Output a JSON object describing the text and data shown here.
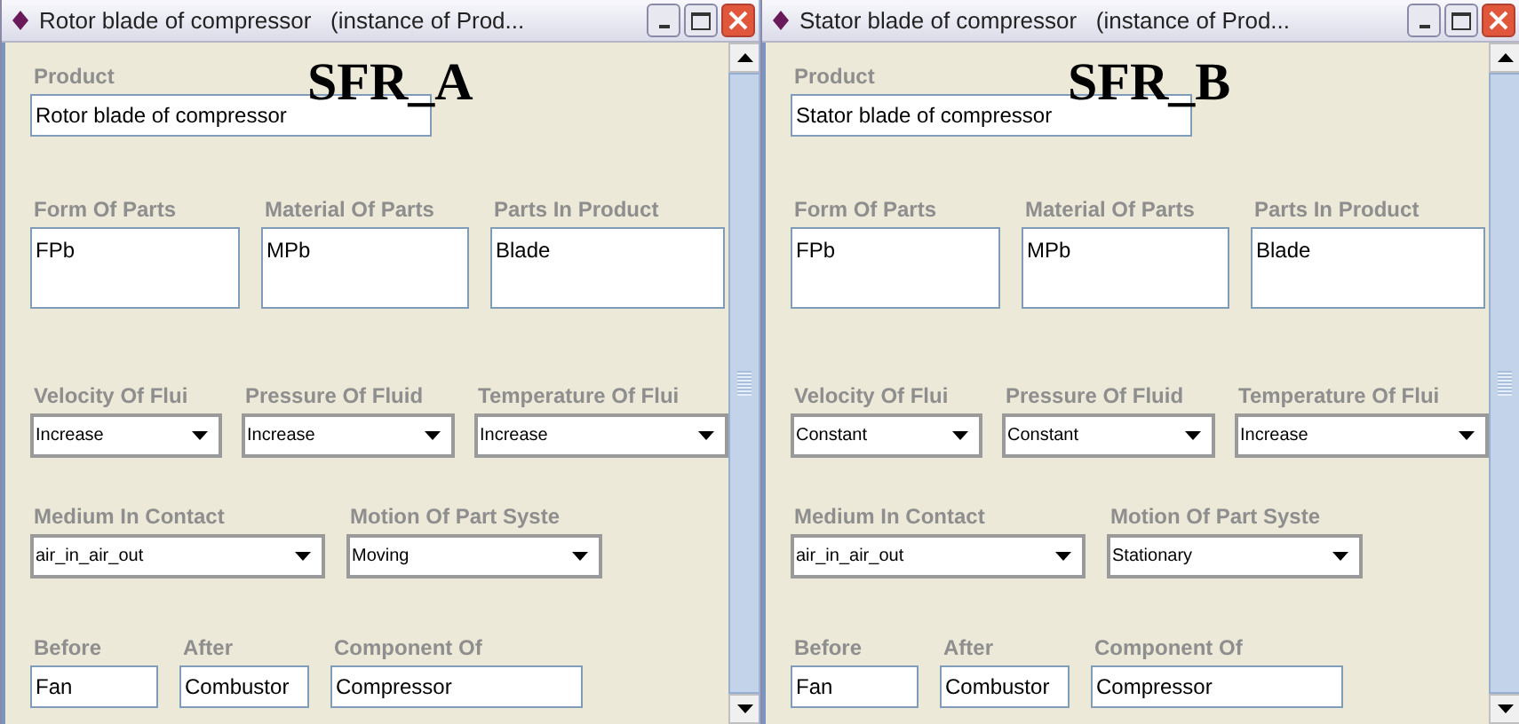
{
  "windows": [
    {
      "title": "Rotor blade of compressor   (instance of Prod...",
      "tag": "SFR_A",
      "groups": [
        {
          "fields": [
            {
              "label": "Product",
              "value": "Rotor blade of compressor",
              "kind": "text"
            }
          ]
        },
        {
          "fields": [
            {
              "label": "Form Of Parts",
              "value": "FPb",
              "kind": "area"
            },
            {
              "label": "Material Of Parts",
              "value": "MPb",
              "kind": "area"
            },
            {
              "label": "Parts In Product",
              "value": "Blade",
              "kind": "area"
            }
          ]
        },
        {
          "fields": [
            {
              "label": "Velocity Of Flui",
              "value": "Increase",
              "kind": "select"
            },
            {
              "label": "Pressure Of Fluid",
              "value": "Increase",
              "kind": "select"
            },
            {
              "label": "Temperature Of Flui",
              "value": "Increase",
              "kind": "select"
            }
          ]
        },
        {
          "fields": [
            {
              "label": "Medium In Contact",
              "value": "air_in_air_out",
              "kind": "select"
            },
            {
              "label": "Motion Of Part Syste",
              "value": "Moving",
              "kind": "select"
            }
          ]
        },
        {
          "fields": [
            {
              "label": "Before",
              "value": "Fan",
              "kind": "text"
            },
            {
              "label": "After",
              "value": "Combustor",
              "kind": "text"
            },
            {
              "label": "Component Of",
              "value": "Compressor",
              "kind": "text"
            }
          ]
        }
      ]
    },
    {
      "title": "Stator blade of compressor   (instance of Prod...",
      "tag": "SFR_B",
      "groups": [
        {
          "fields": [
            {
              "label": "Product",
              "value": "Stator blade of compressor",
              "kind": "text"
            }
          ]
        },
        {
          "fields": [
            {
              "label": "Form Of Parts",
              "value": "FPb",
              "kind": "area"
            },
            {
              "label": "Material Of Parts",
              "value": "MPb",
              "kind": "area"
            },
            {
              "label": "Parts In Product",
              "value": "Blade",
              "kind": "area"
            }
          ]
        },
        {
          "fields": [
            {
              "label": "Velocity Of Flui",
              "value": "Constant",
              "kind": "select"
            },
            {
              "label": "Pressure Of Fluid",
              "value": "Constant",
              "kind": "select"
            },
            {
              "label": "Temperature Of Flui",
              "value": "Increase",
              "kind": "select"
            }
          ]
        },
        {
          "fields": [
            {
              "label": "Medium In Contact",
              "value": "air_in_air_out",
              "kind": "select"
            },
            {
              "label": "Motion Of Part Syste",
              "value": "Stationary",
              "kind": "select"
            }
          ]
        },
        {
          "fields": [
            {
              "label": "Before",
              "value": "Fan",
              "kind": "text"
            },
            {
              "label": "After",
              "value": "Combustor",
              "kind": "text"
            },
            {
              "label": "Component Of",
              "value": "Compressor",
              "kind": "text"
            }
          ]
        }
      ]
    }
  ]
}
